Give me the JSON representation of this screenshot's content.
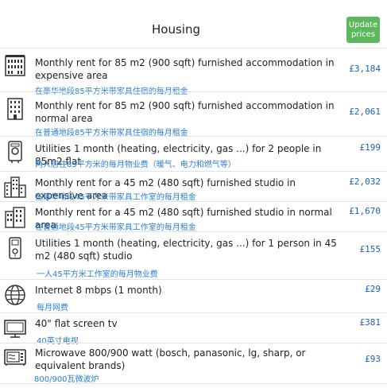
{
  "header": {
    "title": "Housing",
    "update_button": "Update prices"
  },
  "items": [
    {
      "icon": "building-icon",
      "description": "Monthly rent for 85 m2 (900 sqft) furnished accommodation in expensive area",
      "price": "£3,184",
      "translation": "在豪华地段85平方米带家具住宿的每月租金"
    },
    {
      "icon": "office-building-icon",
      "description": "Monthly rent for 85 m2 (900 sqft) furnished accommodation in normal area",
      "price": "£2,061",
      "translation": "在普通地段85平方米带家具住宿的每月租金"
    },
    {
      "icon": "boiler-icon",
      "description": "Utilities 1 month (heating, electricity, gas ...) for 2 people in 85m2 flat",
      "price": "£199",
      "translation": "两人居住85平方米的每月物业费（暖气、电力和燃气等）"
    },
    {
      "icon": "city-buildings-icon",
      "description": "Monthly rent for a 45 m2 (480 sqft) furnished studio in expensive area",
      "price": "£2,032",
      "translation": "在豪华地段45平方米带家具工作室的每月租金"
    },
    {
      "icon": "apartment-buildings-icon",
      "description": "Monthly rent for a 45 m2 (480 sqft) furnished studio in normal area",
      "price": "£1,670",
      "translation": "在普通地段45平方米带家具工作室的每月租金"
    },
    {
      "icon": "utility-meter-icon",
      "description": "Utilities 1 month (heating, electricity, gas ...) for 1 person in 45 m2 (480 sqft) studio",
      "price": "£155",
      "translation": "一人45平方米工作室的每月物业费"
    },
    {
      "icon": "globe-icon",
      "description": "Internet 8 mbps (1 month)",
      "price": "£29",
      "translation": "每月网费"
    },
    {
      "icon": "tv-icon",
      "description": "40\" flat screen tv",
      "price": "£381",
      "translation": "40英寸电视"
    },
    {
      "icon": "microwave-icon",
      "description": "Microwave 800/900 watt (bosch, panasonic, lg, sharp, or equivalent brands)",
      "price": "£93",
      "translation": "800/900瓦微波炉"
    }
  ],
  "colors": {
    "update_button": "#5cb85c",
    "price": "#1a5fb4",
    "translation": "#2a7fd4"
  }
}
